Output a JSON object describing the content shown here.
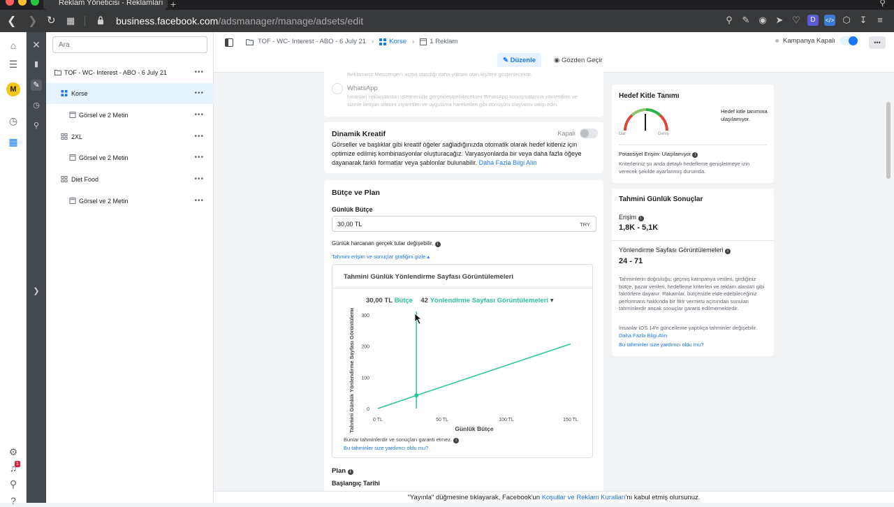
{
  "browser": {
    "tab_title": "Reklam Yöneticisi - Reklamları",
    "url_domain": "business.facebook.com",
    "url_path": "/adsmanager/manage/adsets/edit"
  },
  "colors": {
    "accent": "#1877f2",
    "chart_line": "#2bc4a0",
    "selected_bg": "#e7f3ff"
  },
  "rail": {
    "avatar_letter": "M",
    "notification_count": "1"
  },
  "tree": {
    "search_placeholder": "Ara",
    "campaign": "TOF - WC- Interest - ABO - 6 July 21",
    "adset_1": "Korse",
    "ad_1": "Görsel ve 2 Metin",
    "adset_2": "2XL",
    "ad_2": "Görsel ve 2 Metin",
    "adset_3": "Diet Food",
    "ad_3": "Görsel ve 2 Metin",
    "more": "•••"
  },
  "toolbar": {
    "crumb_campaign": "TOF - WC- Interest - ABO - 6 July 21",
    "crumb_adset": "Korse",
    "crumb_ads": "1 Reklam",
    "campaign_status": "Kampanya Kapalı",
    "edit": "Düzenle",
    "review": "Gözden Geçir",
    "more": "•••"
  },
  "placements": {
    "messenger_desc": "Reklamınız Messenger'ı açma olasılığı daha yüksek olan kişilere gösterilecektir.",
    "whatsapp_title": "WhatsApp",
    "whatsapp_desc_1": "İnsanları reklamlardan işletmenizle gerçekleştirebilecekleri WhatsApp konuşmalarına yönlendirin ve",
    "whatsapp_desc_2": "sizinle iletişim sitesini ziyaretleri ve uygulama hareketleri gibi dönüşüm olaylarını takip edin."
  },
  "dynamic": {
    "title": "Dinamik Kreatif",
    "status": "Kapalı",
    "desc_1": "Görseller ve başlıklar gibi kreatif öğeler sağladığınızda otomatik olarak hedef kitleniz için",
    "desc_2": "optimize edilmiş kombinasyonlar oluşturacağız. Varyasyonlarda bir veya daha fazla öğeye",
    "desc_3": "dayanarak farklı formatlar veya şablonlar bulunabilir.",
    "link": "Daha Fazla Bilgi Alın"
  },
  "budget": {
    "title": "Bütçe ve Plan",
    "daily_label": "Günlük Bütçe",
    "value": "30,00 TL",
    "currency": "TRY",
    "note": "Günlük harcanan gerçek tutar değişebilir.",
    "toggle_chart": "Tahmini erişim ve sonuçlar grafiğini gizle",
    "plan": "Plan",
    "start_date": "Başlangıç Tarihi"
  },
  "chart_panel": {
    "title": "Tahmini Günlük Yönlendirme Sayfası Görüntülemeleri",
    "budget_value": "30,00 TL",
    "budget_word": "Bütçe",
    "result_value": "42",
    "result_word": "Yönlendirme Sayfası Görüntülemeleri",
    "disclaimer": "Bunlar tahminlerdir ve sonuçları garanti etmez.",
    "feedback": "Bu tahminler size yardımcı oldu mu?"
  },
  "chart_data": {
    "type": "line",
    "xlabel": "Günlük Bütçe",
    "ylabel": "Tahmini Günlük Yönlendirme Sayfası Görüntülemeleri",
    "x_ticks": [
      "0 TL",
      "50 TL",
      "100 TL",
      "150 TL"
    ],
    "y_ticks": [
      "0",
      "100",
      "200",
      "300"
    ],
    "xlim": [
      0,
      150
    ],
    "ylim": [
      0,
      300
    ],
    "series": [
      {
        "x": [
          0,
          30,
          150
        ],
        "y": [
          0,
          42,
          207
        ]
      }
    ],
    "marker": {
      "x": 30,
      "y": 42
    },
    "grid": false
  },
  "audience": {
    "title": "Hedef Kitle Tanımı",
    "narrow": "Dar",
    "broad": "Geniş",
    "gauge_note": "Hedef kitle tanımına ulaşılamıyor.",
    "potential_label": "Potansiyel Erişim: Ulaşılamıyor",
    "potential_desc": "Kriterleriniz şu anda detaylı hedefleme genişletmeye izin verecek şekilde ayarlanmış durumda."
  },
  "daily": {
    "title": "Tahmini Günlük Sonuçlar",
    "reach_label": "Erişim",
    "reach_value": "1,8K - 5,1K",
    "views_label": "Yönlendirme Sayfası Görüntülemeleri",
    "views_value": "24 - 71",
    "desc": "Tahminlerin doğruluğu; geçmiş kampanya verileri, girdiğiniz bütçe, pazar verileri, hedefleme kriterleri ve reklam alanları gibi faktörlere dayanır. Rakamlar, bütçenizle elde edebileceğiniz performans hakkında bir fikir vermesi açısından sunulan tahminlerdir ancak sonuçlar garanti edilmemektedir.",
    "ios_note": "İnsanlar iOS 14'e güncelleme yaptıkça tahminler değişebilir.",
    "more_link": "Daha Fazla Bilgi Alın",
    "feedback": "Bu tahminler size yardımcı oldu mu?"
  },
  "footer": {
    "pre": "\"Yayınla\" düğmesine tıklayarak, Facebook'un",
    "link": "Koşullar ve Reklam Kuralları",
    "post": "'nı kabul etmiş olursunuz."
  }
}
